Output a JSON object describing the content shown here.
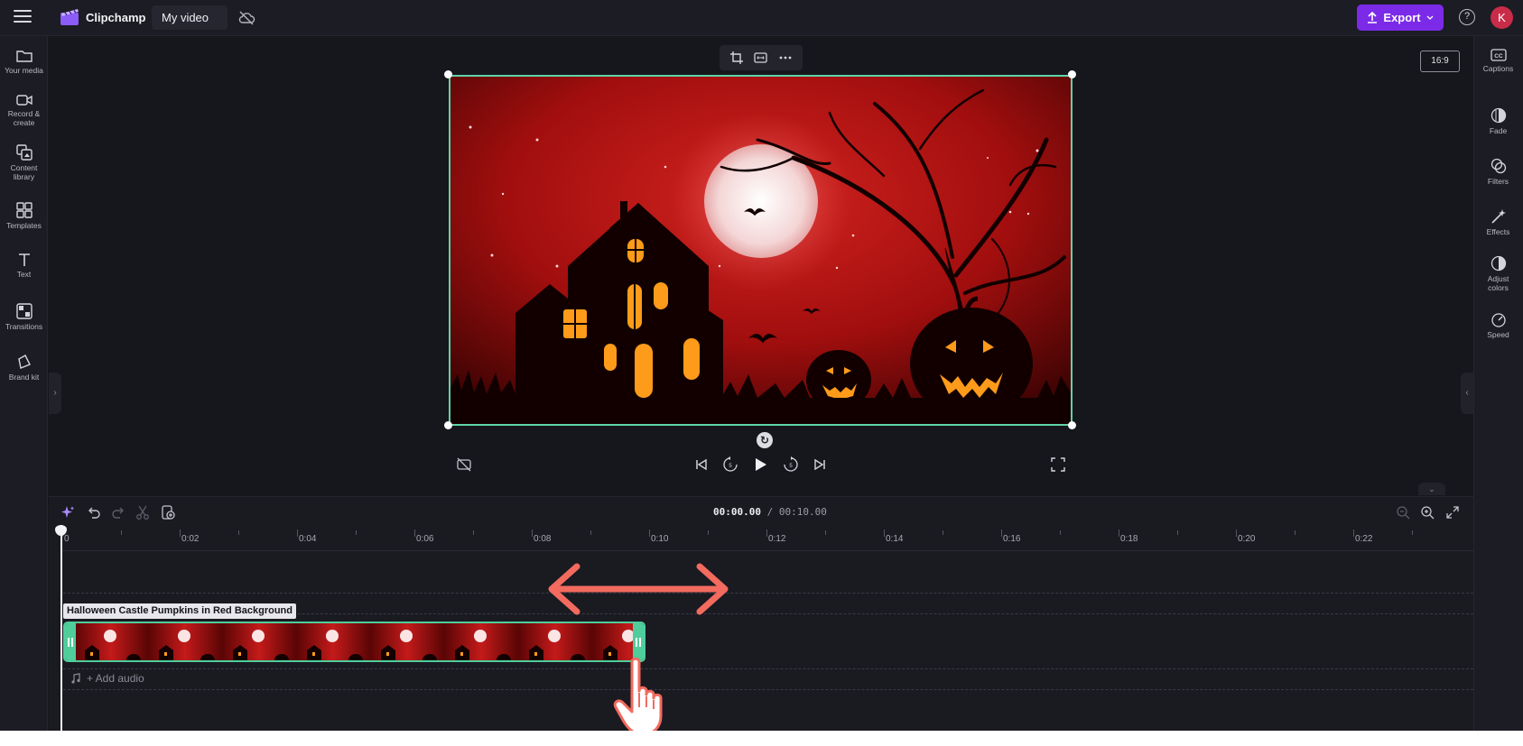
{
  "header": {
    "brand": "Clipchamp",
    "project_name": "My video",
    "export_label": "Export",
    "help_label": "?",
    "avatar_initial": "K"
  },
  "left_sidebar": {
    "items": [
      {
        "label1": "Your media",
        "label2": "",
        "icon": "folder-icon"
      },
      {
        "label1": "Record &",
        "label2": "create",
        "icon": "camera-icon"
      },
      {
        "label1": "Content",
        "label2": "library",
        "icon": "library-icon"
      },
      {
        "label1": "Templates",
        "label2": "",
        "icon": "templates-icon"
      },
      {
        "label1": "Text",
        "label2": "",
        "icon": "text-icon"
      },
      {
        "label1": "Transitions",
        "label2": "",
        "icon": "transitions-icon"
      },
      {
        "label1": "Brand kit",
        "label2": "",
        "icon": "brand-kit-icon"
      }
    ]
  },
  "right_sidebar": {
    "items": [
      {
        "label1": "Captions",
        "label2": "",
        "icon": "captions-icon"
      },
      {
        "label1": "Fade",
        "label2": "",
        "icon": "fade-icon"
      },
      {
        "label1": "Filters",
        "label2": "",
        "icon": "filters-icon"
      },
      {
        "label1": "Effects",
        "label2": "",
        "icon": "effects-icon"
      },
      {
        "label1": "Adjust",
        "label2": "colors",
        "icon": "adjust-colors-icon"
      },
      {
        "label1": "Speed",
        "label2": "",
        "icon": "speed-icon"
      }
    ]
  },
  "preview": {
    "aspect_ratio": "16:9"
  },
  "timeline": {
    "current_time": "00:00.00",
    "separator": " / ",
    "total_time": "00:10.00",
    "ruler_labels": [
      "0",
      "0:02",
      "0:04",
      "0:06",
      "0:08",
      "0:10",
      "0:12",
      "0:14",
      "0:16",
      "0:18",
      "0:20",
      "0:22"
    ],
    "clip_title": "Halloween Castle Pumpkins in Red Background",
    "add_audio_label": "+ Add audio"
  },
  "colors": {
    "accent": "#7b2be8",
    "selection": "#5fd3a8",
    "arrow": "#f26b5e",
    "avatar": "#c82c49"
  }
}
